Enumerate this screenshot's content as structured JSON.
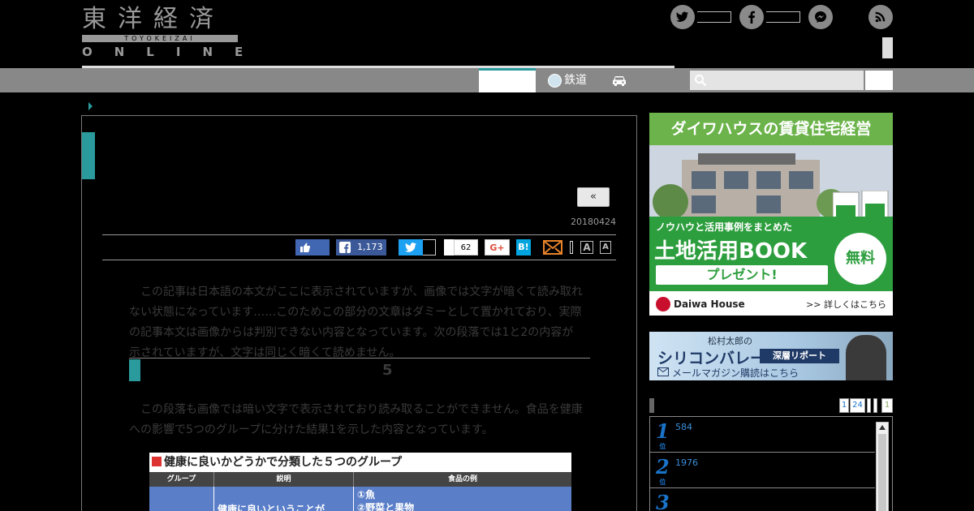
{
  "logo": {
    "kanji": "東洋経済",
    "romaji": "TOYOKEIZAI",
    "online": "ONLINE"
  },
  "header": {
    "social_icons": [
      "twitter-icon",
      "facebook-icon",
      "messenger-icon",
      "rss-icon"
    ]
  },
  "nav": {
    "rail_label": "鉄道",
    "search_placeholder": ""
  },
  "article": {
    "prev_label": "«",
    "date": "20180424",
    "share": {
      "facebook_count": "1,173",
      "pocket_count": "62",
      "gplus_label": "G+",
      "hatena_label": "B!",
      "font_large": "A",
      "font_small": "A"
    },
    "para1": "　この記事は日本語の本文がここに表示されていますが、画像では文字が暗くて読み取れない状態になっています……このためこの部分の文章はダミーとして置かれており、実際の記事本文は画像からは判別できない内容となっています。次の段落では1と2の内容が示されていますが、文字は同じく暗くて読めません。",
    "heading": "　　　　　　　　　　　　　　　　5　",
    "para2": "　この段落も画像では暗い文字で表示されており読み取ることができません。食品を健康への影響で5つのグループに分けた結果1を示した内容となっています。",
    "table": {
      "title": "健康に良いかどうかで分類した５つのグループ",
      "headers": [
        "グループ",
        "説明",
        "食品の例"
      ],
      "row1_desc": "健康に良いということが",
      "row1_examples": [
        "①魚",
        "②野菜と果物"
      ]
    }
  },
  "sidebar": {
    "ad1": {
      "headline": "ダイワハウスの賃貸住宅経営",
      "sub": "ノウハウと活用事例をまとめた",
      "main": "土地活用BOOK",
      "button": "プレゼント!",
      "free": "無料",
      "logo": "Daiwa House",
      "more": ">> 詳しくはこちら"
    },
    "ad2": {
      "name": "松村太郎の",
      "main": "シリコンバレー",
      "tag": "深層リポート",
      "sub": "メールマガジン購読はこちら"
    },
    "ranking": {
      "tabs": [
        "1",
        "24",
        "",
        "",
        "1"
      ],
      "rank_suffix": "位",
      "items": [
        {
          "rank": "1",
          "value": "584"
        },
        {
          "rank": "2",
          "value": "1976"
        },
        {
          "rank": "3",
          "value": ""
        }
      ]
    }
  },
  "colors": {
    "accent": "#2a9a9c",
    "nav_gray": "#888888",
    "link_blue": "#1a73c8"
  }
}
